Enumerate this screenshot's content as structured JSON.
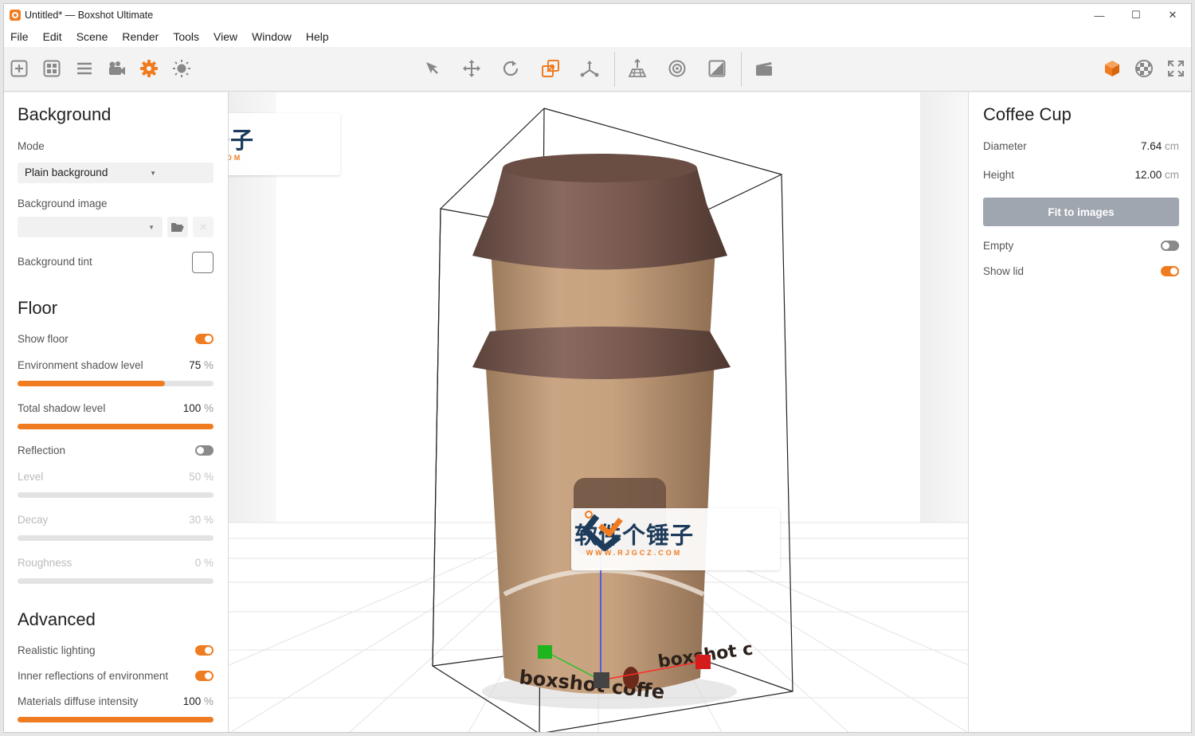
{
  "window": {
    "title": "Untitled* — Boxshot Ultimate",
    "controls": {
      "minimize": "—",
      "maximize": "☐",
      "close": "✕"
    }
  },
  "menu": [
    "File",
    "Edit",
    "Scene",
    "Render",
    "Tools",
    "View",
    "Window",
    "Help"
  ],
  "toolbar": {
    "left": [
      "add-shape-icon",
      "grid-icon",
      "list-icon",
      "camera-icon",
      "gear-icon",
      "light-icon"
    ],
    "center": [
      "select-arrow-icon",
      "move-icon",
      "rotate-icon",
      "scale-icon",
      "arrange-icon"
    ],
    "center2": [
      "floor-grid-icon",
      "camera-target-icon",
      "texture-icon"
    ],
    "center3": [
      "clapperboard-icon"
    ],
    "right": [
      "cube-icon",
      "material-sphere-icon",
      "fullscreen-icon"
    ],
    "accent": "#f07c21"
  },
  "left_panel": {
    "background": {
      "title": "Background",
      "mode_label": "Mode",
      "mode_value": "Plain background",
      "image_label": "Background image",
      "image_value": "",
      "tint_label": "Background tint"
    },
    "floor": {
      "title": "Floor",
      "show_floor_label": "Show floor",
      "show_floor": true,
      "env_shadow_label": "Environment shadow level",
      "env_shadow_value": "75",
      "env_shadow_level": 0.75,
      "total_shadow_label": "Total shadow level",
      "total_shadow_value": "100",
      "total_shadow_level": 1.0,
      "reflection_label": "Reflection",
      "reflection": false,
      "level_label": "Level",
      "level_value": "50",
      "decay_label": "Decay",
      "decay_value": "30",
      "roughness_label": "Roughness",
      "roughness_value": "0",
      "percent": "%"
    },
    "advanced": {
      "title": "Advanced",
      "realistic_label": "Realistic lighting",
      "realistic": true,
      "inner_refl_label": "Inner reflections of environment",
      "inner_refl": true,
      "diffuse_label": "Materials diffuse intensity",
      "diffuse_value": "100",
      "diffuse_level": 1.0
    }
  },
  "viewport": {
    "cup_label_left": "boxshot coffe",
    "cup_label_right": "boxshot c",
    "watermark_text": "软件个锤子",
    "watermark_url": "WWW.RJGCZ.COM"
  },
  "right_panel": {
    "title": "Coffee Cup",
    "diameter_label": "Diameter",
    "diameter_value": "7.64",
    "height_label": "Height",
    "height_value": "12.00",
    "unit": "cm",
    "fit_button": "Fit to images",
    "empty_label": "Empty",
    "empty": false,
    "show_lid_label": "Show lid",
    "show_lid": true
  }
}
